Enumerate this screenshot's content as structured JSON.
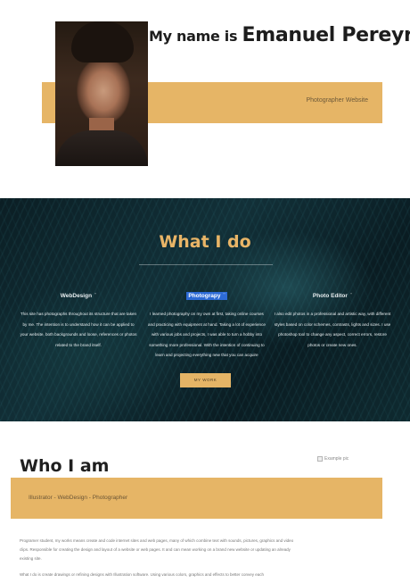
{
  "hero": {
    "title_prefix": "My name is ",
    "title_name": "Emanuel Pereyra",
    "subtitle": "Photographer Website",
    "portrait_alt": "portrait photo",
    "band_color": "#e6b566"
  },
  "services": {
    "title": "What I do",
    "columns": [
      {
        "heading": "WebDesign",
        "mark": "¨",
        "text": "This site has photographs throughout its structure that are taken by me. The intention is to understand how it can be applied to your website, both backgrounds and loose, references or photos related to the brand itself."
      },
      {
        "heading": "Photograpy",
        "mark": "¨",
        "text": "I learned photography on my own at first, taking online courses and practicing with equipment at hand. Taking a lot of experience with various jobs and projects, I was able to turn a hobby into something more professional. With the intention of continuing to learn and projecting everything new that you can acquire"
      },
      {
        "heading": "Photo Editor",
        "mark": "¨",
        "text": "I also edit photos in a professional and artistic way, with different styles based on color schemes, contrasts, lights and sizes. I use photoshop tool to change any aspect, correct errors, restore photos or create new ones."
      }
    ],
    "button_label": "MY WORK",
    "accent_color": "#e9b567"
  },
  "who": {
    "title": "Who I am",
    "image_alt": "Example pic",
    "band_text": "Illustrator - WebDesign - Photographer",
    "paragraphs": [
      "Programer student, my works means create and code internet sites and web pages, many of which combine text with sounds, pictures, graphics and video clips. Responsible for creating the design and layout of a website or web pages. It and can mean working on a brand new website or updating an already existing site.",
      "What I do is create drawings or refining designs with Illustration software. Using various colors, graphics and effects to better convey each"
    ]
  }
}
